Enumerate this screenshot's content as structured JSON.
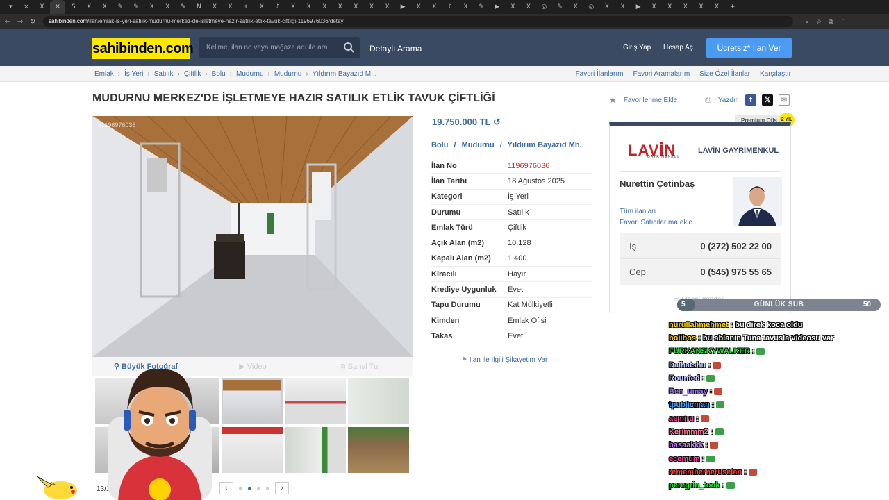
{
  "browser": {
    "tabs": [
      "▾",
      "⨯",
      "X",
      "✕",
      "S",
      "X",
      "X",
      "✎",
      "✎",
      "X",
      "X",
      "✎",
      "N",
      "X",
      "X",
      "⌖",
      "X",
      "♪",
      "X",
      "X",
      "X",
      "X",
      "X",
      "X",
      "X",
      "▶",
      "X",
      "X",
      "♪",
      "X",
      "✎",
      "▶",
      "X",
      "X",
      "◎",
      "✎",
      "X",
      "◎",
      "X",
      "X",
      "▶",
      "X",
      "X",
      "X",
      "X",
      "X",
      "+"
    ],
    "url_host": "sahibinden.com",
    "url_path": "/ilan/emlak-is-yeri-satilik-mudurnu-merkez-de-isletmeye-hazir-satilik-etlik-tavuk-ciftligi-1196976036/detay"
  },
  "header": {
    "logo": "sahibinden.com",
    "search_placeholder": "Kelime, ilan no veya mağaza adı ile ara",
    "advanced_search": "Detaylı Arama",
    "login": "Giriş Yap",
    "register": "Hesap Aç",
    "post_ad": "Ücretsiz* İlan Ver"
  },
  "breadcrumb": [
    "Emlak",
    "İş Yeri",
    "Satılık",
    "Çiftlik",
    "Bolu",
    "Mudurnu",
    "Mudurnu",
    "Yıldırım Bayazıd M..."
  ],
  "quick_links": [
    "Favori İlanlarım",
    "Favori Aramalarım",
    "Size Özel İlanlar",
    "Karşılaştır"
  ],
  "listing": {
    "title": "MUDURNU MERKEZ'DE İŞLETMEYE HAZIR SATILIK ETLİK TAVUK ÇİFTLİĞİ",
    "add_favorite": "Favorilerime Ekle",
    "print": "Yazdır",
    "watermark": "#1196976036",
    "price": "19.750.000 TL",
    "location": [
      "Bolu",
      "Mudurnu",
      "Yıldırım Bayazıd Mh."
    ],
    "media_tabs": [
      "Büyük Fotoğraf",
      "Video",
      "Sanal Tur"
    ],
    "photo_counter": "13/1",
    "complaint": "İlan ile İlgili Şikayetim Var",
    "specs": [
      {
        "k": "İlan No",
        "v": "1196976036"
      },
      {
        "k": "İlan Tarihi",
        "v": "18 Ağustos 2025"
      },
      {
        "k": "Kategori",
        "v": "İş Yeri"
      },
      {
        "k": "Durumu",
        "v": "Satılık"
      },
      {
        "k": "Emlak Türü",
        "v": "Çiftlik"
      },
      {
        "k": "Açık Alan (m2)",
        "v": "10.128"
      },
      {
        "k": "Kapalı Alan (m2)",
        "v": "1.400"
      },
      {
        "k": "Kiracılı",
        "v": "Hayır"
      },
      {
        "k": "Krediye Uygunluk",
        "v": "Evet"
      },
      {
        "k": "Tapu Durumu",
        "v": "Kat Mülkiyetli"
      },
      {
        "k": "Kimden",
        "v": "Emlak Ofisi"
      },
      {
        "k": "Takas",
        "v": "Evet"
      }
    ]
  },
  "agency": {
    "premium": "Premium Ofis",
    "badge": "2 YIL",
    "logo_text": "LAVİN",
    "logo_sub": "GAYRİMENKUL",
    "name": "LAVİN GAYRİMENKUL",
    "agent": "Nurettin Çetinbaş",
    "all_listings": "Tüm ilanları",
    "fav_seller": "Favori Satıcılarıma ekle",
    "phones": [
      {
        "label": "İş",
        "number": "0 (272) 502 22 00"
      },
      {
        "label": "Cep",
        "number": "0 (545) 975 55 65"
      }
    ],
    "message": "Mesaj gönder"
  },
  "overlay": {
    "sub_current": "5",
    "sub_label": "GÜNLÜK SUB",
    "sub_goal": "50",
    "chat": [
      {
        "user": "nurullahmehmet",
        "msg": ": bu direk koca oldu",
        "color": "#ffd200"
      },
      {
        "user": "boiibos",
        "msg": ": bu ablanın Tuna tavusla videosu var",
        "color": "#ffd200"
      },
      {
        "user": "FURKANSKYWALKER",
        "msg": ":",
        "color": "#27e23c"
      },
      {
        "user": "Daihatshu",
        "msg": ":",
        "color": "#c8d0ff"
      },
      {
        "user": "Rounted",
        "msg": ":",
        "color": "#c8d0ff"
      },
      {
        "user": "Ben_umay",
        "msg": ":",
        "color": "#a070ff"
      },
      {
        "user": "tpublicman",
        "msg": ":",
        "color": "#3aa0ff"
      },
      {
        "user": "aemiru",
        "msg": ":",
        "color": "#ff4a9a"
      },
      {
        "user": "Kerimmm2",
        "msg": ":",
        "color": "#ff7aa0"
      },
      {
        "user": "basaakkk",
        "msg": ":",
        "color": "#c07aff"
      },
      {
        "user": "ecemum",
        "msg": ":",
        "color": "#ff3aa0"
      },
      {
        "user": "rememberneruselan",
        "msg": ":",
        "color": "#ff3a3a"
      },
      {
        "user": "peregrin_took",
        "msg": ":",
        "color": "#27e23c"
      }
    ]
  },
  "colors": {
    "brand_yellow": "#ffe800",
    "header": "#3b4a63",
    "link": "#3c6ba5",
    "accent_button": "#4a9bf1",
    "id_red": "#d0302c"
  }
}
